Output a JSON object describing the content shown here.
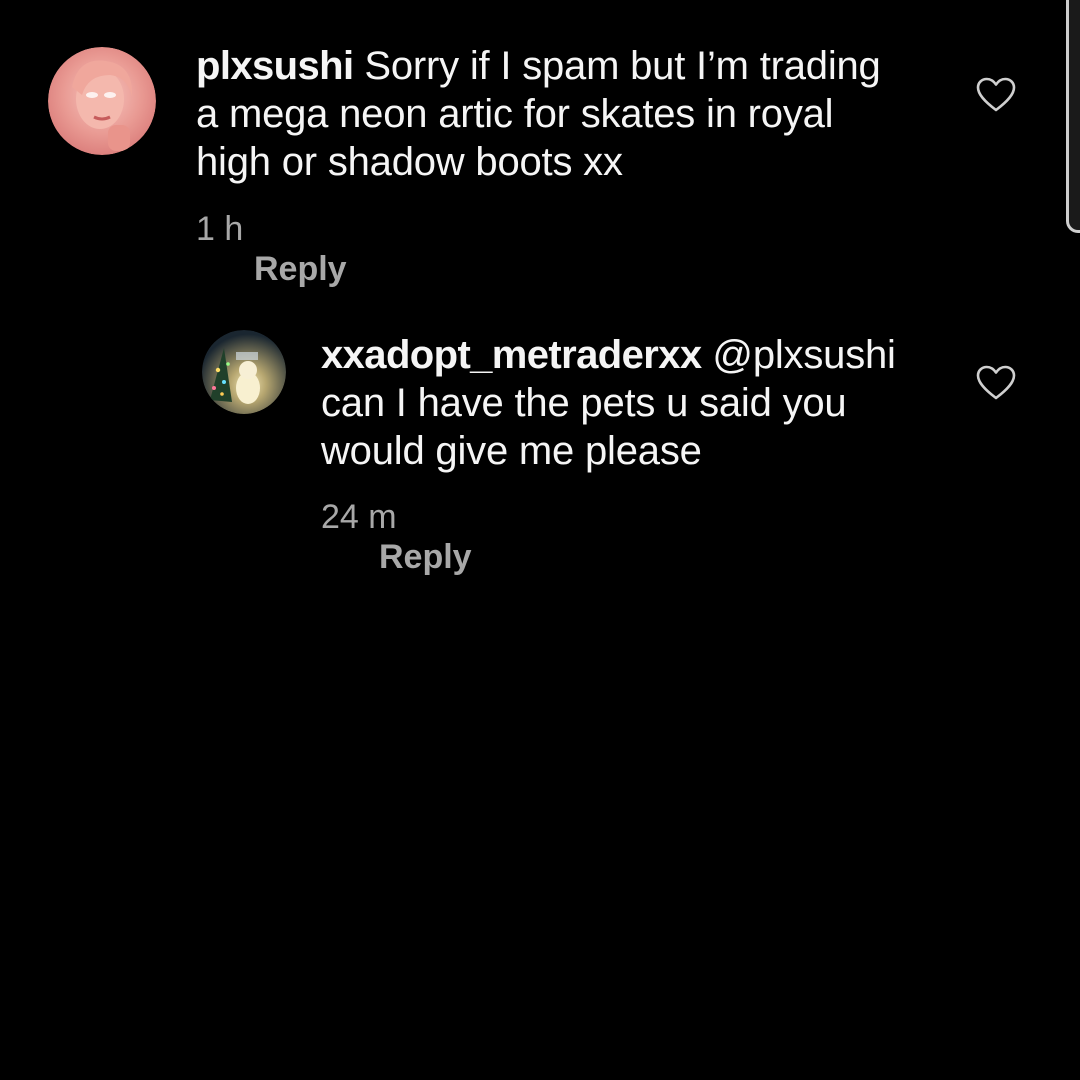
{
  "comments": [
    {
      "username": "plxsushi",
      "text": "Sorry if I spam but I’m trading",
      "text_line2": "a mega neon artic for skates in royal",
      "text_line3": "high or shadow boots xx",
      "time": "1 h",
      "reply_label": "Reply",
      "avatar": "profile-photo"
    },
    {
      "username": "xxadopt_metraderxx",
      "mention": "@plxsushi",
      "text_line2": "can I have the pets u said you",
      "text_line3": "would give me please",
      "time": "24 m",
      "reply_label": "Reply",
      "avatar": "profile-photo"
    }
  ],
  "icons": {
    "like": "heart-outline-icon"
  },
  "colors": {
    "background": "#000000",
    "primary_text": "#f5f5f5",
    "secondary_text": "#a8a8a8"
  }
}
